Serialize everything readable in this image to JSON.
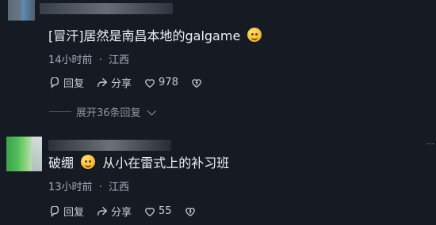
{
  "comment_1": {
    "text": "[冒汗]居然是南昌本地的galgame",
    "emoji": "crying-laughing-face",
    "time": "14小时前",
    "dot": "·",
    "location": "江西",
    "reply_label": "回复",
    "share_label": "分享",
    "like_count": "978",
    "expand_replies": "展开36条回复"
  },
  "comment_2": {
    "prefix": "破绷",
    "emoji": "smiling-face-with-sweat",
    "text": "从小在雷式上的补习班",
    "time": "13小时前",
    "dot": "·",
    "location": "江西",
    "reply_label": "回复",
    "share_label": "分享",
    "like_count": "55"
  },
  "ui": {
    "icons": {
      "reply": "reply-icon",
      "share": "share-icon",
      "like": "heart-icon",
      "dislike": "broken-heart-icon"
    },
    "accent": "#e9edf3",
    "muted": "#a7adb8",
    "background": "#161a22"
  }
}
